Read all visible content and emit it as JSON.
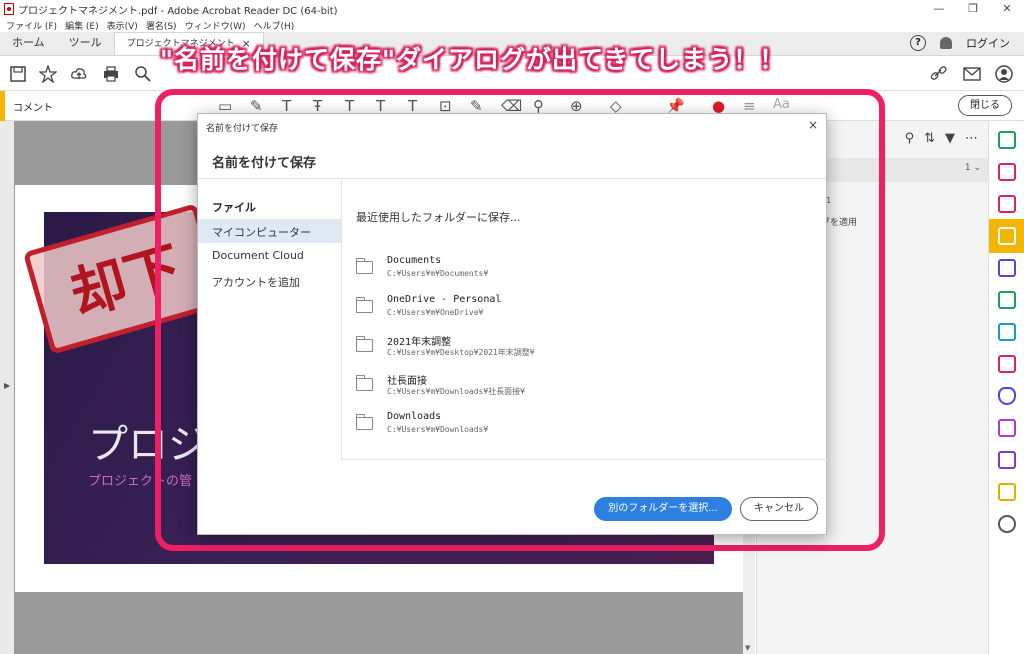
{
  "window": {
    "title": "プロジェクトマネジメント.pdf - Adobe Acrobat Reader DC (64-bit)",
    "controls": [
      "—",
      "❐",
      "✕"
    ]
  },
  "menubar": [
    "ファイル (F)",
    "編集 (E)",
    "表示(V)",
    "署名(S)",
    "ウィンドウ(W)",
    "ヘルプ(H)"
  ],
  "tabs": {
    "home": "ホーム",
    "tools": "ツール",
    "doc": "プロジェクトマネジメント",
    "doc_close": "×",
    "help_icon": "?",
    "login": "ログイン"
  },
  "commentbar": {
    "label": "コメント",
    "close": "閉じる",
    "aa": "Aa"
  },
  "banner": "\"名前を付けて保存\"ダイアログが出てきてしまう！！",
  "document": {
    "stamp": "却下",
    "title": "プロジ",
    "subtitle": "プロジェクトの管"
  },
  "right_panel": {
    "text1": "31",
    "text2": "ブを適用"
  },
  "dialog": {
    "titlebar": "名前を付けて保存",
    "close": "×",
    "heading": "名前を付けて保存",
    "nav_header": "ファイル",
    "nav_items": [
      "マイコンピューター",
      "Document Cloud",
      "アカウントを追加"
    ],
    "recent_header": "最近使用したフォルダーに保存...",
    "folders": [
      {
        "name": "Documents",
        "path": "C:¥Users¥m¥Documents¥"
      },
      {
        "name": "OneDrive - Personal",
        "path": "C:¥Users¥m¥OneDrive¥"
      },
      {
        "name": "2021年末調整",
        "path": "C:¥Users¥m¥Desktop¥2021年末調整¥"
      },
      {
        "name": "社長面接",
        "path": "C:¥Users¥m¥Downloads¥社長面接¥"
      },
      {
        "name": "Downloads",
        "path": "C:¥Users¥m¥Downloads¥"
      }
    ],
    "choose_folder": "別のフォルダーを選択...",
    "cancel": "キャンセル"
  },
  "colors": {
    "accent_blue": "#2d80e0",
    "highlight_pink": "#ee1f63",
    "comment_yellow": "#f2b600"
  }
}
